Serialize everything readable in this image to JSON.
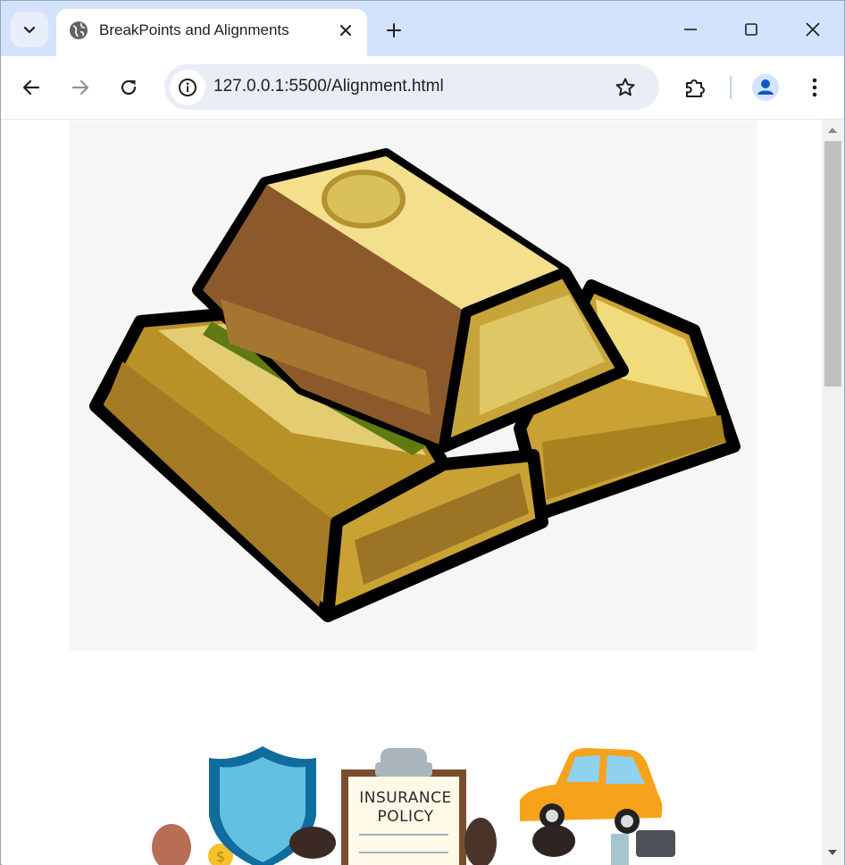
{
  "browser": {
    "tab": {
      "title": "BreakPoints and Alignments",
      "icon": "globe-icon"
    },
    "new_tab_icon": "plus-icon",
    "window_controls": [
      "minimize-icon",
      "maximize-icon",
      "close-icon"
    ],
    "toolbar": {
      "back_icon": "arrow-left-icon",
      "forward_icon": "arrow-right-icon",
      "reload_icon": "reload-icon",
      "url": "127.0.0.1:5500/Alignment.html",
      "site_info_icon": "info-icon",
      "bookmark_icon": "star-icon",
      "extensions_icon": "puzzle-icon",
      "profile_icon": "person-icon",
      "menu_icon": "kebab-menu-icon"
    }
  },
  "page": {
    "images": [
      {
        "name": "gold-bars-image"
      },
      {
        "name": "insurance-illustration-image",
        "text": [
          "INSURANCE",
          "POLICY"
        ]
      }
    ]
  },
  "colors": {
    "tabstrip": "#d3e3fd",
    "omnibox": "#e9eef6",
    "gold_light": "#f3df8c",
    "gold_mid": "#c9a233",
    "gold_dark": "#8c5a2a",
    "shield_blue": "#3d9fd1",
    "car_orange": "#f7a21b"
  }
}
